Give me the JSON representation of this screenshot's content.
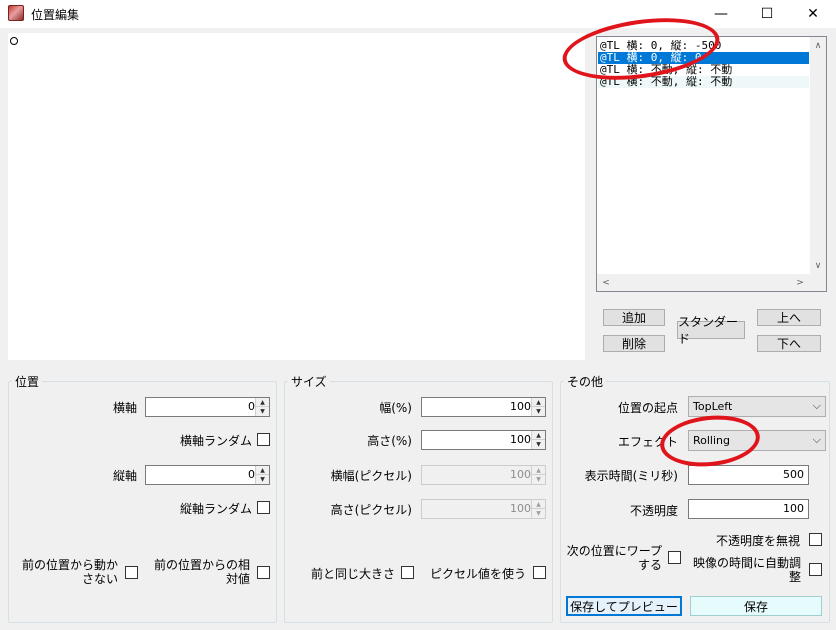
{
  "window": {
    "title": "位置編集",
    "minimize": "—",
    "maximize": "☐",
    "close": "✕"
  },
  "list": {
    "items": [
      {
        "text": "@TL 横: 0, 縦: -500",
        "selected": false
      },
      {
        "text": "@TL 横: 0, 縦: 0",
        "selected": true
      },
      {
        "text": "@TL 横: 不動, 縦: 不動",
        "selected": false
      },
      {
        "text": "@TL 横: 不動, 縦: 不動",
        "selected": false
      }
    ]
  },
  "buttons": {
    "add": "追加",
    "delete": "削除",
    "standard": "スタンダード",
    "up": "上へ",
    "down": "下へ",
    "save_preview": "保存してプレビュー",
    "save": "保存"
  },
  "position": {
    "title": "位置",
    "horizontal_label": "横軸",
    "horizontal_value": "0",
    "horizontal_random_label": "横軸ランダム",
    "vertical_label": "縦軸",
    "vertical_value": "0",
    "vertical_random_label": "縦軸ランダム",
    "not_move_label": "前の位置から動かさない",
    "relative_label": "前の位置からの相対値"
  },
  "size": {
    "title": "サイズ",
    "width_pct_label": "幅(%)",
    "width_pct_value": "100",
    "height_pct_label": "高さ(%)",
    "height_pct_value": "100",
    "width_px_label": "横幅(ピクセル)",
    "width_px_value": "100",
    "height_px_label": "高さ(ピクセル)",
    "height_px_value": "100",
    "same_size_label": "前と同じ大きさ",
    "use_pixel_label": "ピクセル値を使う"
  },
  "other": {
    "title": "その他",
    "origin_label": "位置の起点",
    "origin_value": "TopLeft",
    "effect_label": "エフェクト",
    "effect_value": "Rolling",
    "duration_label": "表示時間(ミリ秒)",
    "duration_value": "500",
    "opacity_label": "不透明度",
    "opacity_value": "100",
    "warp_label": "次の位置にワープする",
    "ignore_opacity_label": "不透明度を無視",
    "auto_adjust_label": "映像の時間に自動調整"
  },
  "icons": {
    "spin_up": "▲",
    "spin_down": "▼",
    "combo_arrow": "⌵",
    "scroll_up": "∧",
    "scroll_down": "∨",
    "scroll_left": "<",
    "scroll_right": ">"
  },
  "colors": {
    "selection": "#0078d7",
    "annotation": "#e0141b"
  }
}
